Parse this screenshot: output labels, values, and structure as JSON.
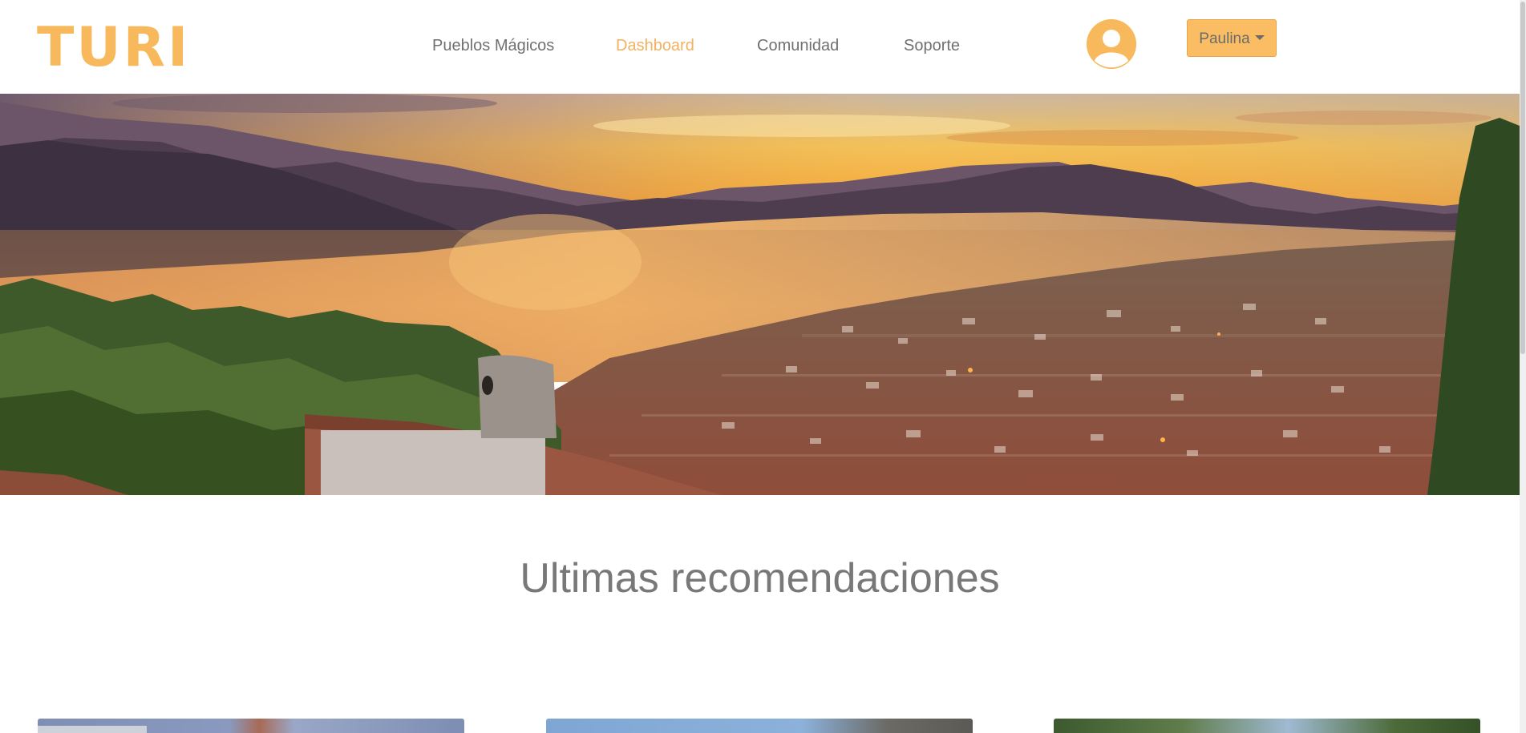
{
  "brand": {
    "logo": "TURI",
    "color": "#f8b95c"
  },
  "nav": {
    "items": [
      {
        "label": "Pueblos Mágicos",
        "active": false
      },
      {
        "label": "Dashboard",
        "active": true
      },
      {
        "label": "Comunidad",
        "active": false
      },
      {
        "label": "Soporte",
        "active": false
      }
    ],
    "active_color": "#f4b15f"
  },
  "user": {
    "avatar_icon": "user-avatar-icon",
    "name": "Paulina",
    "caret_icon": "caret-down-icon"
  },
  "hero": {
    "image": "sunset over lake and hillside town"
  },
  "recommendations": {
    "title": "Ultimas recomendaciones",
    "cards": [
      {
        "image": "church-photo"
      },
      {
        "image": "street-photo"
      },
      {
        "image": "garden-photo"
      }
    ]
  }
}
